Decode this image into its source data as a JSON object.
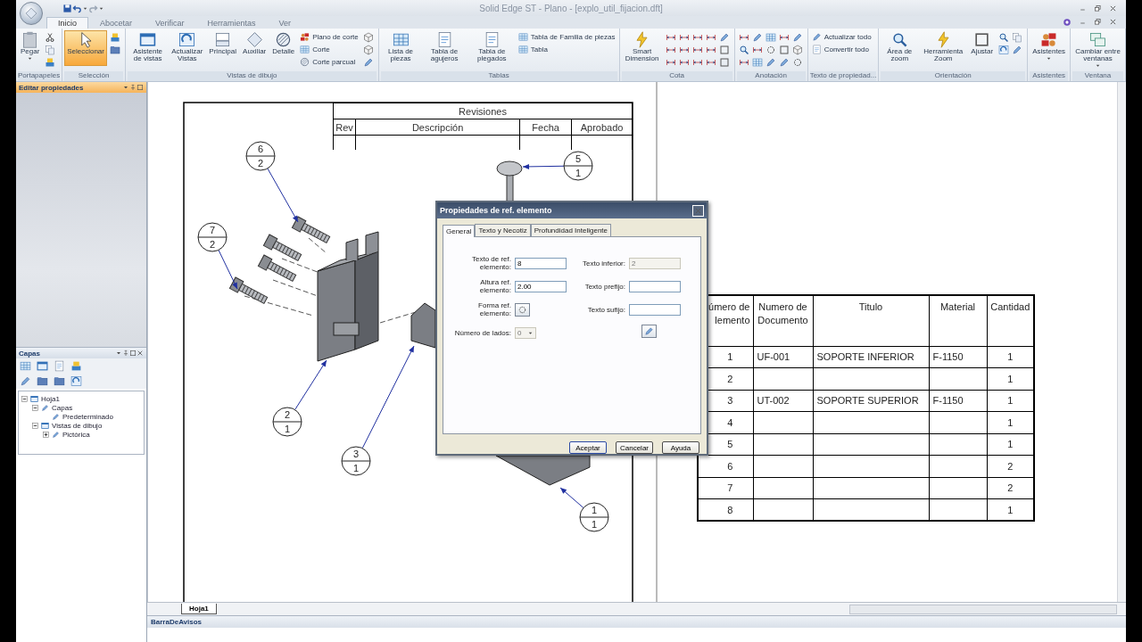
{
  "window": {
    "title": "Solid Edge ST - Plano - [explo_util_fijacion.dft]"
  },
  "ribbon_tabs": [
    {
      "label": "Inicio",
      "selected": true
    },
    {
      "label": "Abocetar",
      "selected": false
    },
    {
      "label": "Verificar",
      "selected": false
    },
    {
      "label": "Herramientas",
      "selected": false
    },
    {
      "label": "Ver",
      "selected": false
    }
  ],
  "ribbon_groups": [
    {
      "label": "Portapapeles",
      "tools": [
        {
          "label": "Pegar",
          "kind": "large",
          "dropdown": true
        }
      ]
    },
    {
      "label": "Selección",
      "tools": [
        {
          "label": "Seleccionar",
          "kind": "large",
          "selected": true
        }
      ]
    },
    {
      "label": "Vistas de dibujo",
      "tools": [
        {
          "label": "Asistente de vistas",
          "kind": "large"
        },
        {
          "label": "Actualizar Vistas",
          "kind": "large"
        },
        {
          "label": "Principal",
          "kind": "large"
        },
        {
          "label": "Auxiliar",
          "kind": "large"
        },
        {
          "label": "Detalle",
          "kind": "large"
        },
        {
          "label": "Plano de corte",
          "kind": "small"
        },
        {
          "label": "Corte",
          "kind": "small"
        },
        {
          "label": "Corte parcual",
          "kind": "small"
        }
      ]
    },
    {
      "label": "Tablas",
      "tools": [
        {
          "label": "Lista de piezas",
          "kind": "large"
        },
        {
          "label": "Tabla de agujeros",
          "kind": "large"
        },
        {
          "label": "Tabla de plegados",
          "kind": "large"
        },
        {
          "label": "Tabla de Familia de piezas",
          "kind": "small"
        },
        {
          "label": "Tabla",
          "kind": "small"
        }
      ]
    },
    {
      "label": "Cota",
      "tools": [
        {
          "label": "Smart Dimension",
          "kind": "large"
        }
      ]
    },
    {
      "label": "Anotación"
    },
    {
      "label": "Texto de propiedad...",
      "tools": [
        {
          "label": "Actualizar todo",
          "kind": "small"
        },
        {
          "label": "Convertir todo",
          "kind": "small"
        }
      ]
    },
    {
      "label": "Orientación",
      "tools": [
        {
          "label": "Área de zoom",
          "kind": "large"
        },
        {
          "label": "Herramienta Zoom",
          "kind": "large"
        },
        {
          "label": "Ajustar",
          "kind": "large"
        }
      ]
    },
    {
      "label": "Asistentes",
      "tools": [
        {
          "label": "Asistentes",
          "kind": "large",
          "dropdown": true
        }
      ]
    },
    {
      "label": "Ventana",
      "tools": [
        {
          "label": "Cambiar entre ventanas",
          "kind": "large",
          "dropdown": true
        }
      ]
    }
  ],
  "properties_panel": {
    "title": "Editar propiedades"
  },
  "layers_panel": {
    "title": "Capas",
    "tree": [
      {
        "label": "Hoja1",
        "expanded": true,
        "children": [
          {
            "label": "Capas",
            "expanded": true,
            "children": [
              {
                "label": "Predeterminado"
              }
            ]
          },
          {
            "label": "Vistas de dibujo",
            "expanded": true,
            "children": [
              {
                "label": "Pictórica",
                "expanded": false
              }
            ]
          }
        ]
      }
    ]
  },
  "revisions_table": {
    "title": "Revisiones",
    "columns": [
      "Rev",
      "Descripción",
      "Fecha",
      "Aprobado"
    ]
  },
  "balloons": [
    {
      "number": "6",
      "quantity": "2"
    },
    {
      "number": "5",
      "quantity": "1"
    },
    {
      "number": "7",
      "quantity": "2"
    },
    {
      "number": "2",
      "quantity": "1"
    },
    {
      "number": "3",
      "quantity": "1"
    },
    {
      "number": "1",
      "quantity": "1"
    }
  ],
  "parts_list": {
    "columns": [
      "úmero de lemento",
      "Numero de Documento",
      "Titulo",
      "Material",
      "Cantidad"
    ],
    "rows": [
      [
        "1",
        "UF-001",
        "SOPORTE INFERIOR",
        "F-1150",
        "1"
      ],
      [
        "2",
        "",
        "",
        "",
        "1"
      ],
      [
        "3",
        "UT-002",
        "SOPORTE SUPERIOR",
        "F-1150",
        "1"
      ],
      [
        "4",
        "",
        "",
        "",
        "1"
      ],
      [
        "5",
        "",
        "",
        "",
        "1"
      ],
      [
        "6",
        "",
        "",
        "",
        "2"
      ],
      [
        "7",
        "",
        "",
        "",
        "2"
      ],
      [
        "8",
        "",
        "",
        "",
        "1"
      ]
    ]
  },
  "dialog": {
    "title": "Propiedades de ref. elemento",
    "tabs": [
      {
        "label": "General",
        "selected": true
      },
      {
        "label": "Texto y Necotiz",
        "selected": false
      },
      {
        "label": "Profundidad Inteligente",
        "selected": false
      }
    ],
    "left_fields": [
      {
        "label": "Texto de ref. elemento:",
        "kind": "text",
        "value": "8",
        "disabled": false
      },
      {
        "label": "Altura ref. elemento:",
        "kind": "text",
        "value": "2.00",
        "disabled": false
      },
      {
        "label": "Forma ref. elemento:",
        "kind": "shape"
      },
      {
        "label": "Número de lados:",
        "kind": "select",
        "value": "0",
        "disabled": true
      }
    ],
    "right_fields": [
      {
        "label": "Texto inferior:",
        "kind": "text",
        "value": "2",
        "disabled": true
      },
      {
        "label": "Texto prefijo:",
        "kind": "text",
        "disabled": false
      },
      {
        "label": "Texto sufijo:",
        "kind": "text",
        "disabled": false
      }
    ],
    "buttons": [
      "Aceptar",
      "Cancelar",
      "Ayuda"
    ]
  },
  "sheet_tabs": [
    {
      "label": "Hoja1",
      "selected": true
    }
  ],
  "status_bar": {
    "title": "BarraDeAvisos"
  }
}
